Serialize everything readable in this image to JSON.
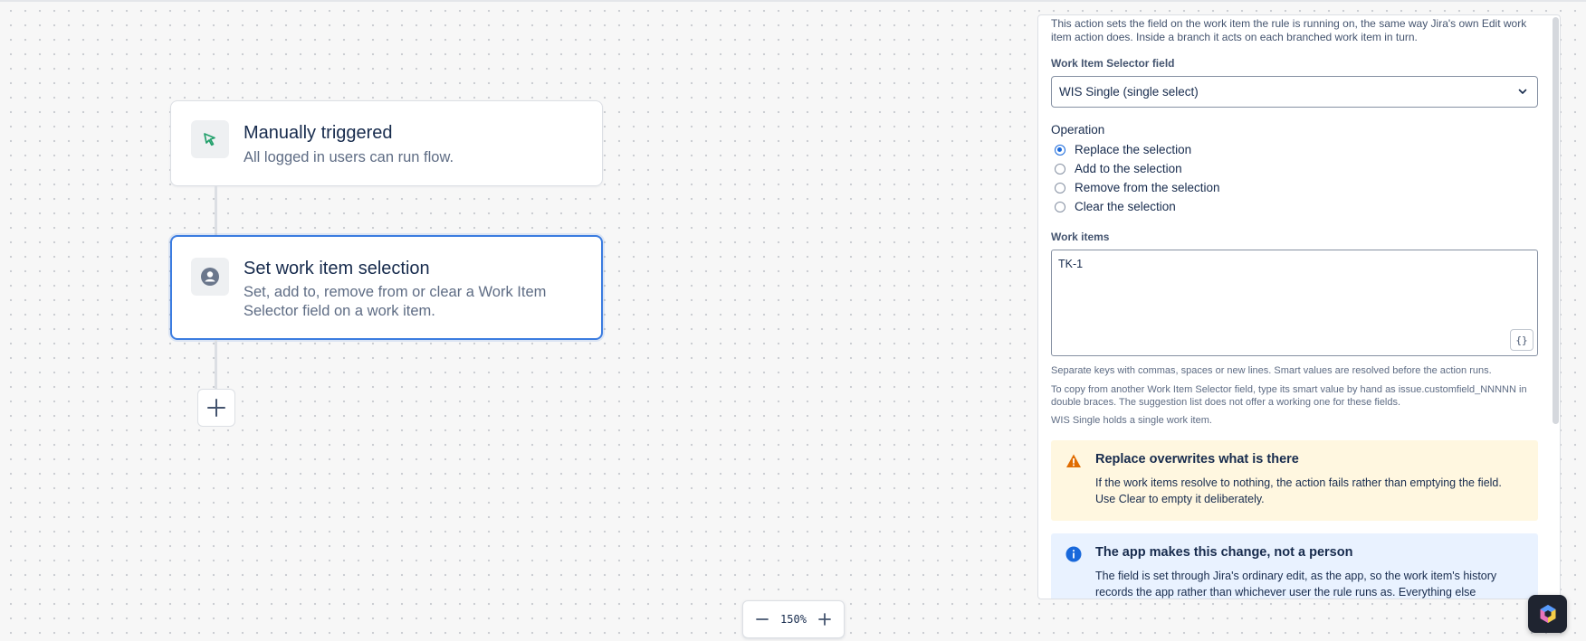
{
  "canvas": {
    "trigger": {
      "title": "Manually triggered",
      "description": "All logged in users can run flow.",
      "icon": "cursor-click-icon"
    },
    "action": {
      "title": "Set work item selection",
      "description": "Set, add to, remove from or clear a Work Item Selector field on a work item.",
      "icon": "user-circle-icon"
    },
    "add_icon": "plus-icon"
  },
  "zoom": {
    "level": "150%",
    "out_icon": "minus-icon",
    "in_icon": "plus-icon"
  },
  "panel": {
    "intro": "This action sets the field on the work item the rule is running on, the same way Jira's own Edit work item action does. Inside a branch it acts on each branched work item in turn.",
    "selector_field": {
      "label": "Work Item Selector field",
      "value": "WIS Single (single select)"
    },
    "operation": {
      "label": "Operation",
      "options": [
        {
          "label": "Replace the selection",
          "checked": true
        },
        {
          "label": "Add to the selection",
          "checked": false
        },
        {
          "label": "Remove from the selection",
          "checked": false
        },
        {
          "label": "Clear the selection",
          "checked": false
        }
      ]
    },
    "work_items": {
      "label": "Work items",
      "value": "TK-1",
      "smart_value_button": "{}"
    },
    "help": [
      "Separate keys with commas, spaces or new lines. Smart values are resolved before the action runs.",
      "To copy from another Work Item Selector field, type its smart value by hand as issue.customfield_NNNNN in double braces. The suggestion list does not offer a working one for these fields.",
      "WIS Single holds a single work item."
    ],
    "warning": {
      "title": "Replace overwrites what is there",
      "body": "If the work items resolve to nothing, the action fails rather than emptying the field. Use Clear to empty it deliberately.",
      "color": "#fff7e0",
      "icon_color": "#e06c00"
    },
    "info": {
      "title": "The app makes this change, not a person",
      "body": "The field is set through Jira's ordinary edit, as the app, so the work item's history records the app rather than whichever user the rule runs as. Everything else",
      "color": "#e9f2ff",
      "icon_color": "#1868db"
    }
  },
  "accent_color": "#3b7ce0"
}
